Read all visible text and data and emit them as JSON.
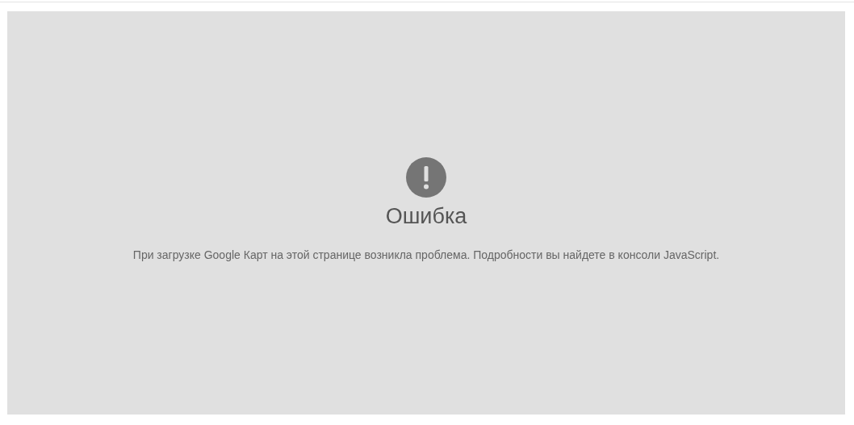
{
  "error": {
    "title": "Ошибка",
    "message": "При загрузке Google Карт на этой странице возникла проблема. Подробности вы найдете в консоли JavaScript."
  }
}
